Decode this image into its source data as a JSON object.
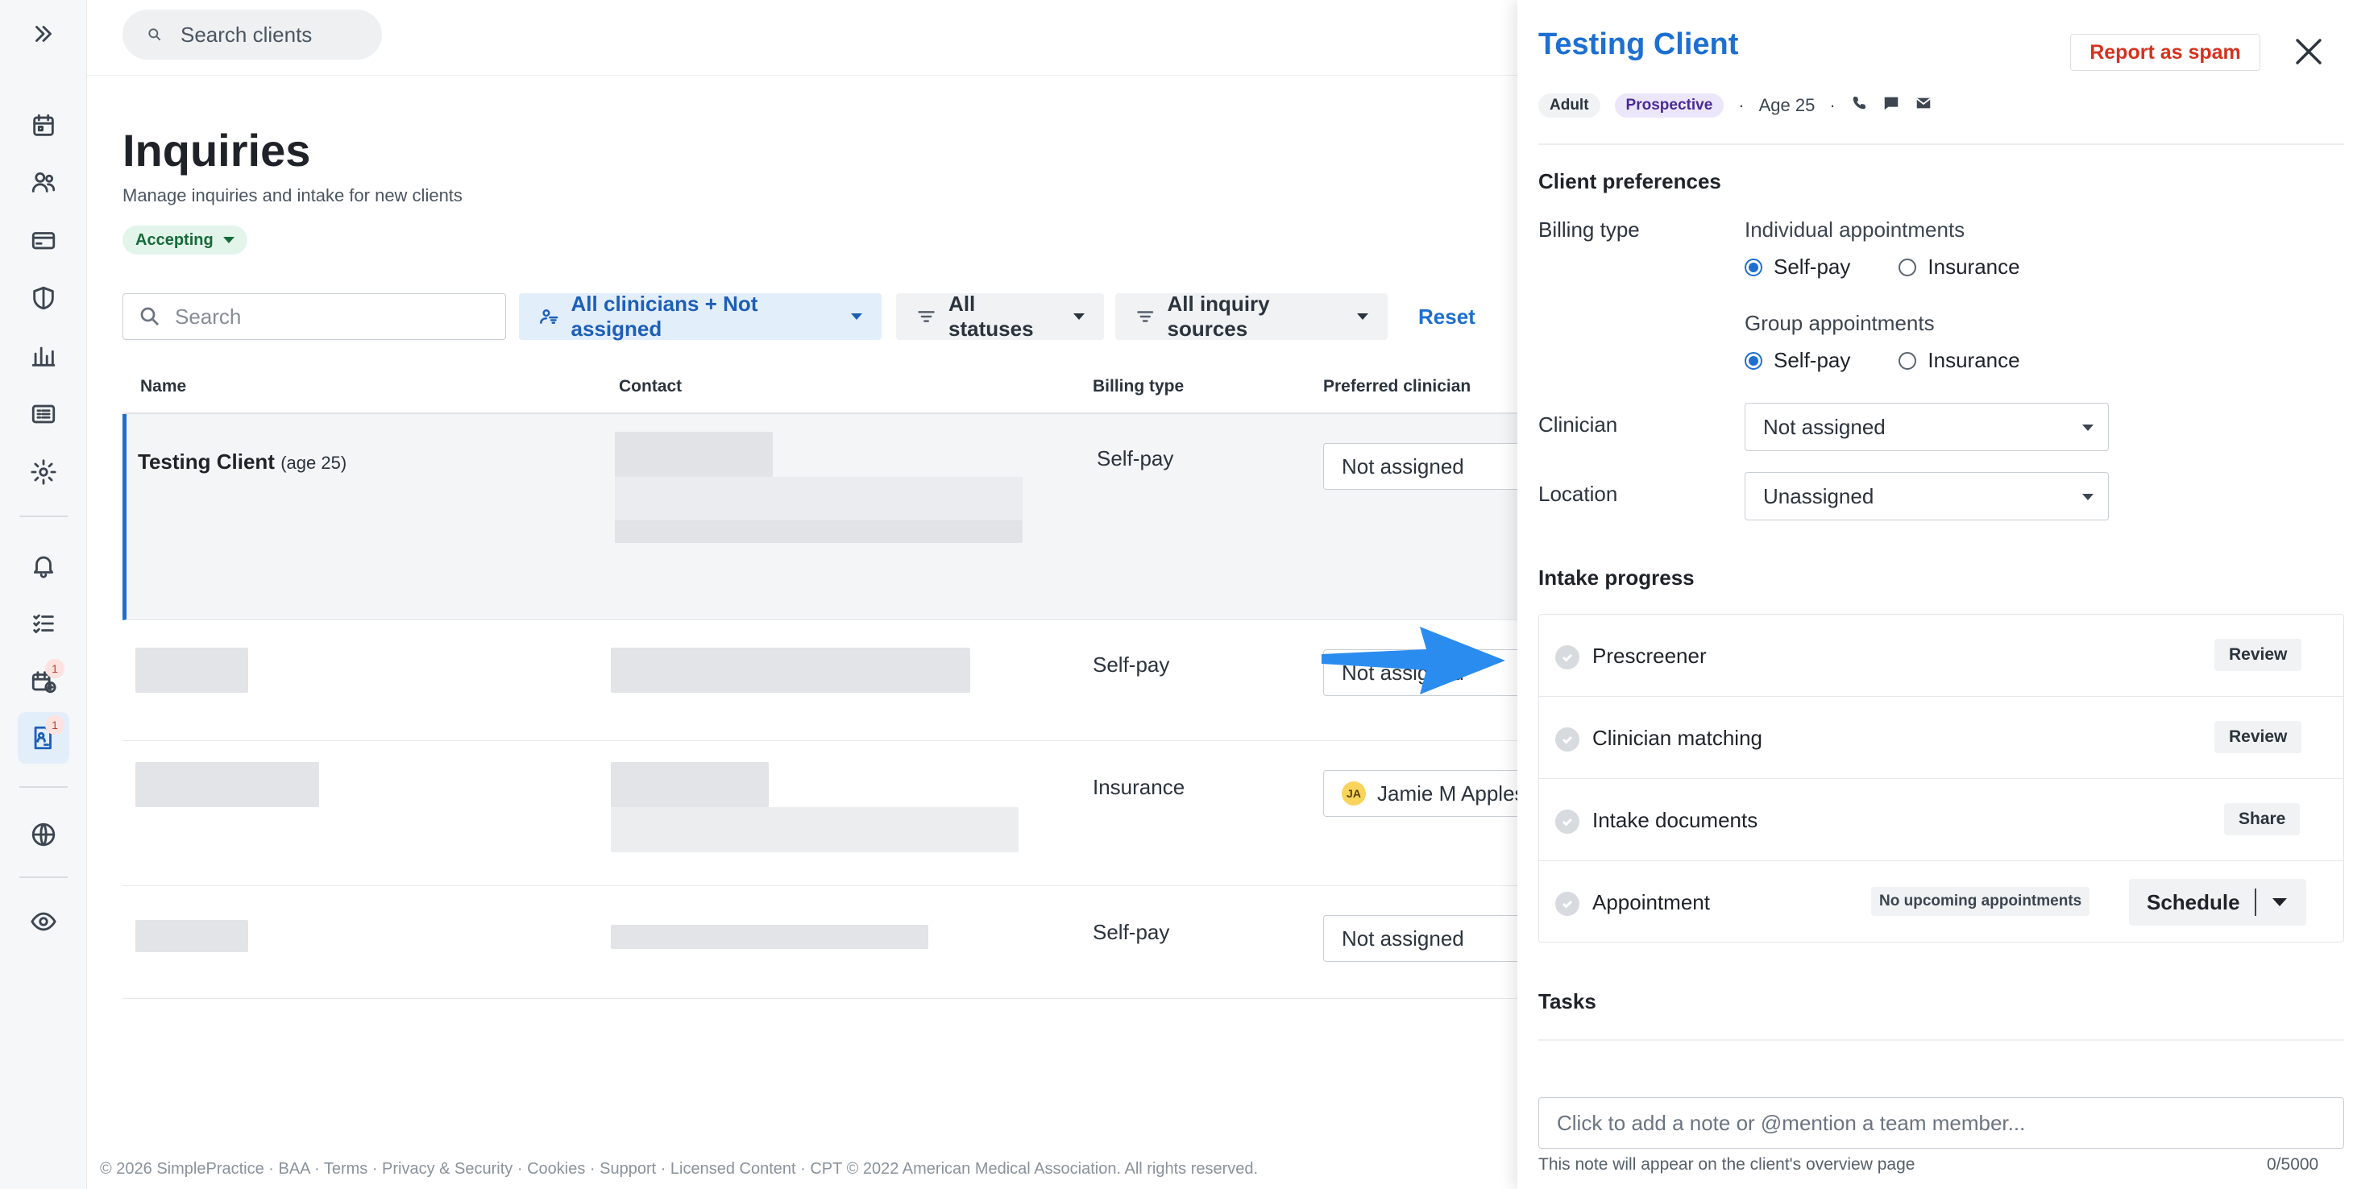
{
  "top_search": {
    "placeholder": "Search clients"
  },
  "page": {
    "title": "Inquiries",
    "subtitle": "Manage inquiries and intake for new clients",
    "status": "Accepting"
  },
  "filters": {
    "search_placeholder": "Search",
    "clinicians": "All clinicians + Not assigned",
    "statuses": "All statuses",
    "sources": "All inquiry sources",
    "reset": "Reset"
  },
  "table": {
    "headers": [
      "Name",
      "Contact",
      "Billing type",
      "Preferred clinician"
    ],
    "rows": [
      {
        "name": "Testing Client",
        "age": "(age 25)",
        "billing": "Self-pay",
        "clinician": "Not assigned",
        "initials": ""
      },
      {
        "name": "",
        "age": "",
        "billing": "Self-pay",
        "clinician": "Not assigned",
        "initials": ""
      },
      {
        "name": "",
        "age": "",
        "billing": "Insurance",
        "clinician": "Jamie M Apples",
        "initials": "JA"
      },
      {
        "name": "",
        "age": "",
        "billing": "Self-pay",
        "clinician": "Not assigned",
        "initials": ""
      }
    ]
  },
  "footer": "© 2026 SimplePractice · BAA · Terms · Privacy & Security · Cookies · Support · Licensed Content · CPT © 2022 American Medical Association. All rights reserved.",
  "rail": {
    "badge_1": "1",
    "badge_2": "1"
  },
  "panel": {
    "client_name": "Testing Client",
    "spam_button": "Report as spam",
    "tags": [
      "Adult",
      "Prospective"
    ],
    "age": "Age 25",
    "client_prefs_heading": "Client preferences",
    "billing_type_label": "Billing type",
    "individual_label": "Individual appointments",
    "group_label": "Group appointments",
    "self_pay": "Self-pay",
    "insurance": "Insurance",
    "clinician_label": "Clinician",
    "clinician_value": "Not assigned",
    "location_label": "Location",
    "location_value": "Unassigned",
    "intake_heading": "Intake progress",
    "intake": [
      {
        "label": "Prescreener",
        "action": "Review"
      },
      {
        "label": "Clinician matching",
        "action": "Review"
      },
      {
        "label": "Intake documents",
        "action": "Share"
      },
      {
        "label": "Appointment",
        "status": "No upcoming appointments",
        "action": "Schedule"
      }
    ],
    "tasks_heading": "Tasks",
    "note_placeholder": "Click to add a note or @mention a team member...",
    "note_help": "This note will appear on the client's overview page",
    "note_count": "0/5000"
  },
  "colors": {
    "accent": "#1d6fd1",
    "spam": "#d4321f",
    "arrow": "#2b8cef"
  }
}
